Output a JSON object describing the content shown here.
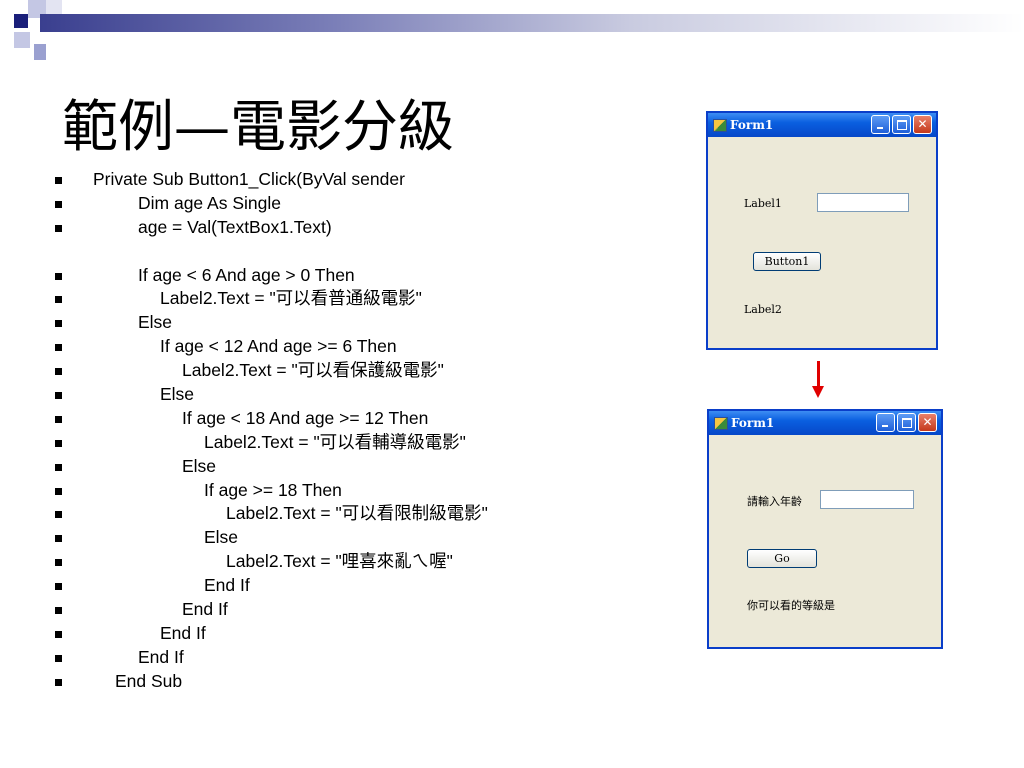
{
  "slide": {
    "title": "範例—電影分級",
    "code_lines": [
      {
        "indent": 0,
        "text": "Private Sub Button1_Click(ByVal sender"
      },
      {
        "indent": 2,
        "text": "Dim age As Single"
      },
      {
        "indent": 2,
        "text": "age = Val(TextBox1.Text)"
      },
      {
        "indent": -1,
        "text": ""
      },
      {
        "indent": 2,
        "text": "If age < 6 And age > 0 Then"
      },
      {
        "indent": 3,
        "text": "Label2.Text = \"可以看普通級電影\""
      },
      {
        "indent": 2,
        "text": "Else"
      },
      {
        "indent": 3,
        "text": "If age < 12 And age >= 6 Then"
      },
      {
        "indent": 4,
        "text": "Label2.Text = \"可以看保護級電影\""
      },
      {
        "indent": 3,
        "text": "Else"
      },
      {
        "indent": 4,
        "text": "If age < 18 And age >= 12 Then"
      },
      {
        "indent": 5,
        "text": "Label2.Text = \"可以看輔導級電影\""
      },
      {
        "indent": 4,
        "text": "Else"
      },
      {
        "indent": 5,
        "text": "If age >= 18 Then"
      },
      {
        "indent": 6,
        "text": "Label2.Text = \"可以看限制級電影\""
      },
      {
        "indent": 5,
        "text": "Else"
      },
      {
        "indent": 6,
        "text": "Label2.Text = \"哩喜來亂ㄟ喔\""
      },
      {
        "indent": 5,
        "text": "End If"
      },
      {
        "indent": 4,
        "text": "End If"
      },
      {
        "indent": 3,
        "text": "End If"
      },
      {
        "indent": 2,
        "text": "End If"
      },
      {
        "indent": 1,
        "text": "End Sub"
      }
    ]
  },
  "form_design": {
    "title": "Form1",
    "label1": "Label1",
    "button1": "Button1",
    "label2": "Label2"
  },
  "form_run": {
    "title": "Form1",
    "label1": "請輸入年齡",
    "button1": "Go",
    "label2": "你可以看的等級是"
  },
  "colors": {
    "titlebar": "#0a5fe0",
    "form_bg": "#ece9d8",
    "arrow": "#e00000",
    "deco_dark": "#1a1f7a",
    "deco_light": "#9aa0d0"
  }
}
